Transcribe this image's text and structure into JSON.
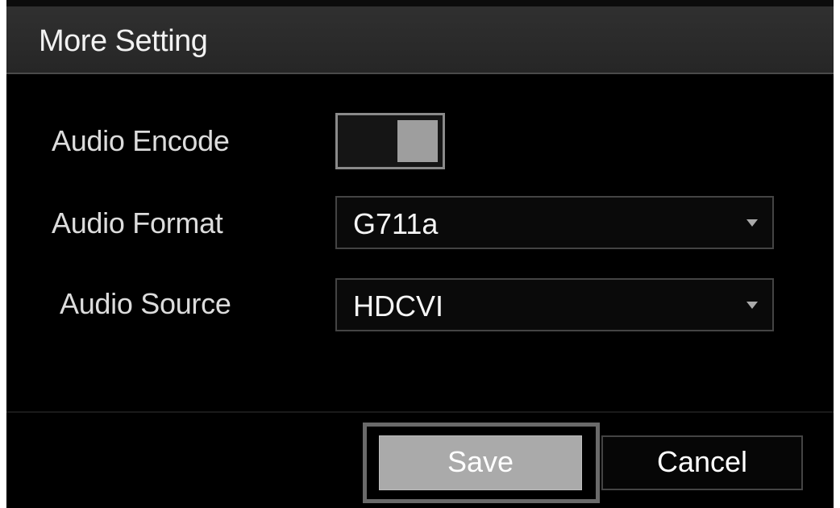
{
  "dialog": {
    "title": "More Setting"
  },
  "fields": {
    "audio_encode": {
      "label": "Audio Encode",
      "enabled": true
    },
    "audio_format": {
      "label": "Audio Format",
      "value": "G711a"
    },
    "audio_source": {
      "label": "Audio Source",
      "value": "HDCVI"
    }
  },
  "buttons": {
    "save_label": "Save",
    "cancel_label": "Cancel"
  },
  "colors": {
    "background": "#000000",
    "title_bar": "#2b2b2b",
    "text": "#dcdcdc",
    "save_button": "#aaaaaa",
    "toggle_knob": "#9e9e9e"
  },
  "icons": {
    "dropdown": "caret-down-icon"
  }
}
